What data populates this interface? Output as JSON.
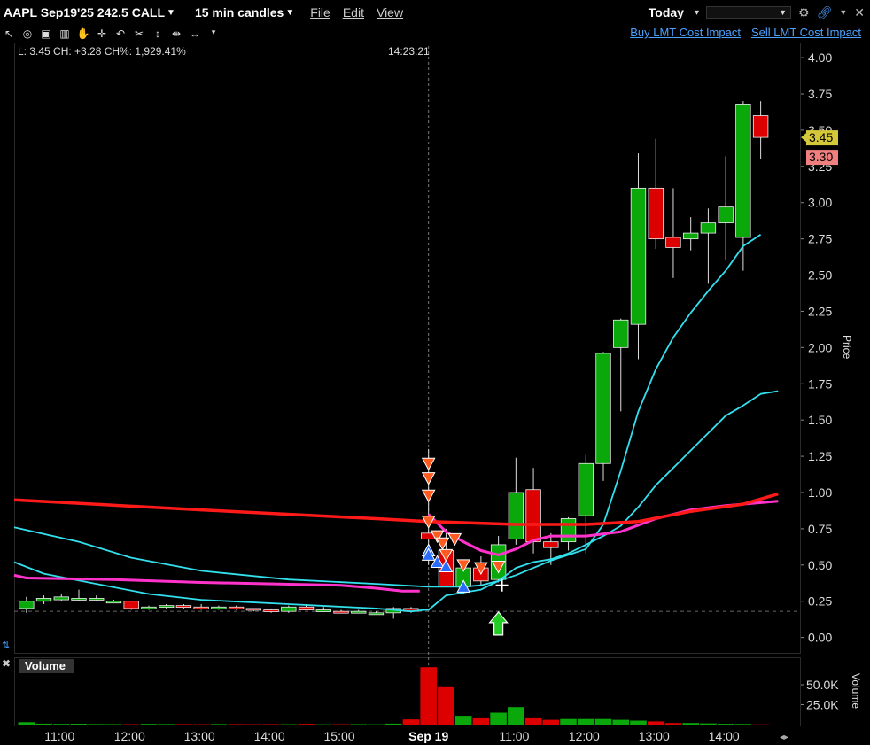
{
  "header": {
    "symbol": "AAPL Sep19'25 242.5 CALL",
    "interval": "15 min candles",
    "menu_file": "File",
    "menu_edit": "Edit",
    "menu_view": "View",
    "period": "Today"
  },
  "toolbar": {
    "buy_link": "Buy LMT Cost Impact",
    "sell_link": "Sell LMT Cost Impact",
    "icons": [
      "crosshair-icon",
      "save-icon",
      "bar-icon",
      "hand-icon",
      "plus-icon",
      "undo-icon",
      "tool-icon",
      "vertical-icon",
      "dash-icon",
      "split-icon",
      "dropdown-icon"
    ]
  },
  "info": {
    "line": "L: 3.45 CH: +3.28 CH%: 1,929.41%",
    "time": "14:23:21"
  },
  "price_axis": {
    "label": "Price",
    "ticks": [
      "4.00",
      "3.75",
      "3.50",
      "3.25",
      "3.00",
      "2.75",
      "2.50",
      "2.25",
      "2.00",
      "1.75",
      "1.50",
      "1.25",
      "1.00",
      "0.75",
      "0.50",
      "0.25",
      "0.00"
    ],
    "last_price": "3.45",
    "bid_price": "3.30"
  },
  "volume_axis": {
    "label": "Volume",
    "panel_label": "Volume",
    "ticks": [
      "50.0K",
      "25.0K"
    ]
  },
  "time_axis": {
    "ticks": [
      "11:00",
      "12:00",
      "13:00",
      "14:00",
      "15:00",
      "Sep 19",
      "11:00",
      "12:00",
      "13:00",
      "14:00"
    ]
  },
  "colors": {
    "up": "#0aa80a",
    "down": "#dd0000",
    "ma_red": "#ff1a1a",
    "ma_magenta": "#ff33cc",
    "ma_cyan": "#33e0ee",
    "accent_link": "#4aa3ff",
    "last_price_bg": "#d4c83a",
    "bid_price_bg": "#f08080"
  },
  "chart_data": {
    "type": "candlestick",
    "ylim": [
      -0.1,
      4.08
    ],
    "x_index_range": [
      -0.7,
      44.3
    ],
    "session_break_index": 23,
    "candles": [
      {
        "o": 0.2,
        "h": 0.28,
        "l": 0.17,
        "c": 0.25
      },
      {
        "o": 0.25,
        "h": 0.29,
        "l": 0.23,
        "c": 0.27
      },
      {
        "o": 0.26,
        "h": 0.3,
        "l": 0.25,
        "c": 0.28
      },
      {
        "o": 0.27,
        "h": 0.33,
        "l": 0.25,
        "c": 0.27
      },
      {
        "o": 0.27,
        "h": 0.29,
        "l": 0.25,
        "c": 0.27
      },
      {
        "o": 0.25,
        "h": 0.26,
        "l": 0.24,
        "c": 0.25
      },
      {
        "o": 0.25,
        "h": 0.25,
        "l": 0.19,
        "c": 0.2
      },
      {
        "o": 0.2,
        "h": 0.22,
        "l": 0.19,
        "c": 0.21
      },
      {
        "o": 0.21,
        "h": 0.23,
        "l": 0.2,
        "c": 0.22
      },
      {
        "o": 0.22,
        "h": 0.23,
        "l": 0.2,
        "c": 0.21
      },
      {
        "o": 0.21,
        "h": 0.23,
        "l": 0.19,
        "c": 0.2
      },
      {
        "o": 0.2,
        "h": 0.22,
        "l": 0.19,
        "c": 0.21
      },
      {
        "o": 0.21,
        "h": 0.22,
        "l": 0.19,
        "c": 0.2
      },
      {
        "o": 0.2,
        "h": 0.2,
        "l": 0.18,
        "c": 0.19
      },
      {
        "o": 0.19,
        "h": 0.2,
        "l": 0.17,
        "c": 0.18
      },
      {
        "o": 0.18,
        "h": 0.22,
        "l": 0.17,
        "c": 0.21
      },
      {
        "o": 0.21,
        "h": 0.23,
        "l": 0.19,
        "c": 0.19
      },
      {
        "o": 0.19,
        "h": 0.21,
        "l": 0.18,
        "c": 0.19
      },
      {
        "o": 0.18,
        "h": 0.19,
        "l": 0.17,
        "c": 0.17
      },
      {
        "o": 0.18,
        "h": 0.19,
        "l": 0.17,
        "c": 0.18
      },
      {
        "o": 0.17,
        "h": 0.18,
        "l": 0.16,
        "c": 0.17
      },
      {
        "o": 0.17,
        "h": 0.21,
        "l": 0.13,
        "c": 0.2
      },
      {
        "o": 0.2,
        "h": 0.21,
        "l": 0.17,
        "c": 0.18
      },
      {
        "o": 0.72,
        "h": 1.3,
        "l": 0.5,
        "c": 0.68
      },
      {
        "o": 0.6,
        "h": 0.75,
        "l": 0.4,
        "c": 0.35
      },
      {
        "o": 0.35,
        "h": 0.52,
        "l": 0.3,
        "c": 0.48
      },
      {
        "o": 0.48,
        "h": 0.56,
        "l": 0.36,
        "c": 0.39
      },
      {
        "o": 0.4,
        "h": 0.7,
        "l": 0.38,
        "c": 0.64
      },
      {
        "o": 0.68,
        "h": 1.24,
        "l": 0.64,
        "c": 1.0
      },
      {
        "o": 1.02,
        "h": 1.17,
        "l": 0.58,
        "c": 0.66
      },
      {
        "o": 0.66,
        "h": 0.72,
        "l": 0.5,
        "c": 0.62
      },
      {
        "o": 0.66,
        "h": 0.83,
        "l": 0.6,
        "c": 0.82
      },
      {
        "o": 0.84,
        "h": 1.26,
        "l": 0.58,
        "c": 1.2
      },
      {
        "o": 1.2,
        "h": 1.97,
        "l": 1.08,
        "c": 1.96
      },
      {
        "o": 2.0,
        "h": 2.2,
        "l": 1.56,
        "c": 2.19
      },
      {
        "o": 2.16,
        "h": 3.34,
        "l": 1.92,
        "c": 3.1
      },
      {
        "o": 3.1,
        "h": 3.44,
        "l": 2.68,
        "c": 2.75
      },
      {
        "o": 2.76,
        "h": 3.1,
        "l": 2.48,
        "c": 2.69
      },
      {
        "o": 2.75,
        "h": 2.9,
        "l": 2.67,
        "c": 2.79
      },
      {
        "o": 2.79,
        "h": 2.96,
        "l": 2.44,
        "c": 2.86
      },
      {
        "o": 2.86,
        "h": 3.32,
        "l": 2.6,
        "c": 2.97
      },
      {
        "o": 2.76,
        "h": 3.7,
        "l": 2.53,
        "c": 3.68
      },
      {
        "o": 3.6,
        "h": 3.7,
        "l": 3.3,
        "c": 3.45
      }
    ],
    "volume": [
      3000,
      1200,
      900,
      1100,
      700,
      600,
      500,
      900,
      700,
      600,
      500,
      700,
      600,
      500,
      600,
      500,
      900,
      400,
      500,
      600,
      400,
      1200,
      6500,
      72000,
      48000,
      11000,
      9000,
      15000,
      22000,
      9000,
      6000,
      7000,
      7000,
      7000,
      6000,
      5000,
      4000,
      2000,
      2000,
      1500,
      1000,
      800,
      300
    ],
    "volume_ylim": [
      0,
      80000
    ],
    "ma_red": [
      [
        -0.7,
        0.95
      ],
      [
        10,
        0.88
      ],
      [
        20,
        0.82
      ],
      [
        23,
        0.8
      ],
      [
        28,
        0.78
      ],
      [
        32,
        0.78
      ],
      [
        35,
        0.8
      ],
      [
        38,
        0.87
      ],
      [
        41,
        0.92
      ],
      [
        43,
        0.99
      ]
    ],
    "ma_magenta": [
      [
        -0.7,
        0.43
      ],
      [
        0,
        0.41
      ],
      [
        5,
        0.4
      ],
      [
        10,
        0.38
      ],
      [
        18,
        0.36
      ],
      [
        20,
        0.34
      ],
      [
        21.5,
        0.32
      ],
      [
        22.5,
        0.32
      ]
    ],
    "ma_magenta2": [
      [
        23,
        0.85
      ],
      [
        24,
        0.73
      ],
      [
        25,
        0.66
      ],
      [
        26,
        0.6
      ],
      [
        27,
        0.57
      ],
      [
        28,
        0.61
      ],
      [
        29,
        0.67
      ],
      [
        30,
        0.7
      ],
      [
        32,
        0.7
      ],
      [
        34,
        0.73
      ],
      [
        36,
        0.82
      ],
      [
        38,
        0.88
      ],
      [
        40,
        0.91
      ],
      [
        43,
        0.94
      ]
    ],
    "ma_cyan_slow": [
      [
        -0.7,
        0.76
      ],
      [
        3,
        0.66
      ],
      [
        6,
        0.55
      ],
      [
        10,
        0.46
      ],
      [
        15,
        0.4
      ],
      [
        20,
        0.37
      ],
      [
        23,
        0.35
      ],
      [
        25,
        0.35
      ],
      [
        26,
        0.36
      ],
      [
        27,
        0.39
      ],
      [
        28,
        0.48
      ],
      [
        29,
        0.52
      ],
      [
        30,
        0.54
      ],
      [
        31,
        0.58
      ],
      [
        32,
        0.64
      ],
      [
        33,
        0.7
      ],
      [
        34,
        0.77
      ],
      [
        35,
        0.9
      ],
      [
        36,
        1.05
      ],
      [
        37,
        1.17
      ],
      [
        38,
        1.29
      ],
      [
        39,
        1.41
      ],
      [
        40,
        1.53
      ],
      [
        41,
        1.6
      ],
      [
        42,
        1.68
      ],
      [
        43,
        1.7
      ]
    ],
    "ma_cyan_fast": [
      [
        -0.7,
        0.52
      ],
      [
        1,
        0.44
      ],
      [
        4,
        0.37
      ],
      [
        7,
        0.3
      ],
      [
        10,
        0.26
      ],
      [
        15,
        0.23
      ],
      [
        20,
        0.2
      ],
      [
        22,
        0.18
      ],
      [
        22.8,
        0.19
      ],
      [
        23,
        0.19
      ],
      [
        24,
        0.29
      ],
      [
        25,
        0.31
      ],
      [
        26,
        0.33
      ],
      [
        27,
        0.39
      ],
      [
        28,
        0.43
      ],
      [
        29,
        0.48
      ],
      [
        30,
        0.53
      ],
      [
        31,
        0.57
      ],
      [
        32,
        0.61
      ],
      [
        33,
        0.78
      ],
      [
        34,
        1.15
      ],
      [
        35,
        1.56
      ],
      [
        36,
        1.85
      ],
      [
        37,
        2.07
      ],
      [
        38,
        2.24
      ],
      [
        39,
        2.39
      ],
      [
        40,
        2.53
      ],
      [
        41,
        2.7
      ],
      [
        42,
        2.78
      ]
    ],
    "dashed_level": 0.18,
    "sell_markers": [
      [
        23,
        1.2
      ],
      [
        23,
        1.1
      ],
      [
        23,
        0.98
      ],
      [
        23,
        0.8
      ],
      [
        23.5,
        0.7
      ],
      [
        23.8,
        0.65
      ],
      [
        24.5,
        0.68
      ],
      [
        24,
        0.57
      ],
      [
        25,
        0.5
      ],
      [
        26,
        0.48
      ],
      [
        27,
        0.49
      ]
    ],
    "buy_markers": [
      [
        23,
        0.6
      ],
      [
        23,
        0.57
      ],
      [
        23.5,
        0.52
      ],
      [
        24,
        0.49
      ],
      [
        25,
        0.35
      ]
    ],
    "entry_arrow_index": 27,
    "entry_arrow_value": 0.09,
    "cross_marker": [
      27.2,
      0.36
    ]
  }
}
